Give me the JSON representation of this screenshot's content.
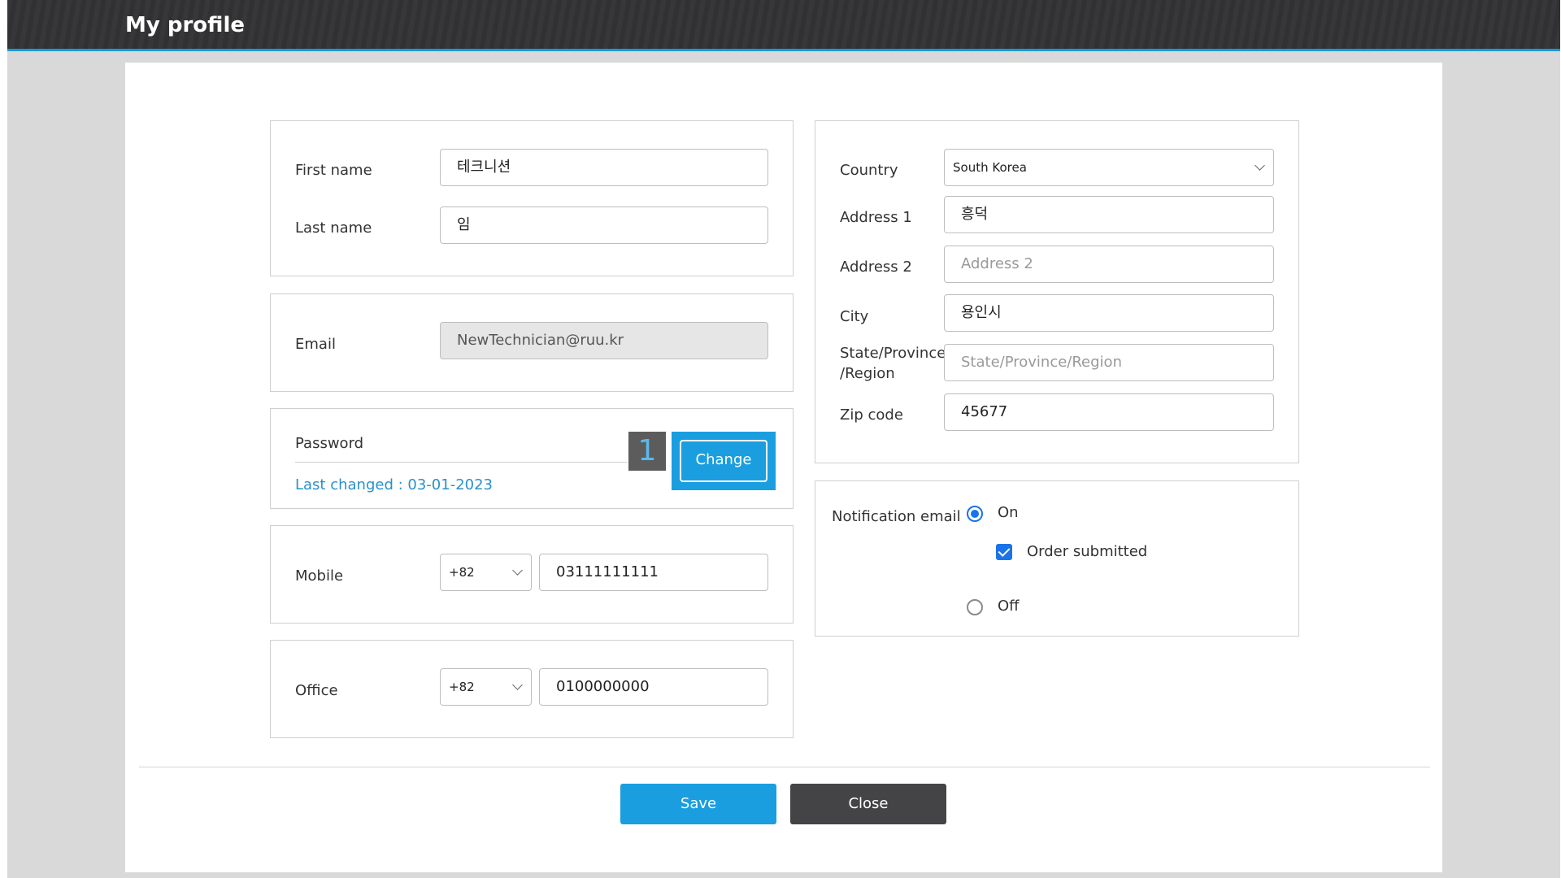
{
  "window": {
    "title": "My profile"
  },
  "name": {
    "first_label": "First name",
    "first_value": "테크니션",
    "last_label": "Last name",
    "last_value": "임"
  },
  "email": {
    "label": "Email",
    "value": "NewTechnician@ruu.kr"
  },
  "password": {
    "label": "Password",
    "last_changed": "Last changed : 03-01-2023",
    "change_button": "Change",
    "step_badge": "1"
  },
  "mobile": {
    "label": "Mobile",
    "country_code": "+82",
    "number": "03111111111"
  },
  "office": {
    "label": "Office",
    "country_code": "+82",
    "number": "0100000000"
  },
  "address": {
    "country_label": "Country",
    "country_value": "South Korea",
    "address1_label": "Address 1",
    "address1_value": "흥덕",
    "address2_label": "Address 2",
    "address2_placeholder": "Address 2",
    "city_label": "City",
    "city_value": "용인시",
    "state_label_1": "State/Province",
    "state_label_2": "/Region",
    "state_placeholder": "State/Province/Region",
    "zip_label": "Zip code",
    "zip_value": "45677"
  },
  "notification": {
    "label": "Notification email",
    "on_label": "On",
    "on_selected": true,
    "order_submitted_label": "Order submitted",
    "order_submitted_checked": true,
    "off_label": "Off",
    "off_selected": false
  },
  "footer": {
    "save_label": "Save",
    "close_label": "Close"
  },
  "colors": {
    "accent": "#1a9ee0",
    "titlebar": "#333335",
    "close_button": "#444446",
    "link": "#2a90cc",
    "badge_bg": "#5c5c5c"
  }
}
